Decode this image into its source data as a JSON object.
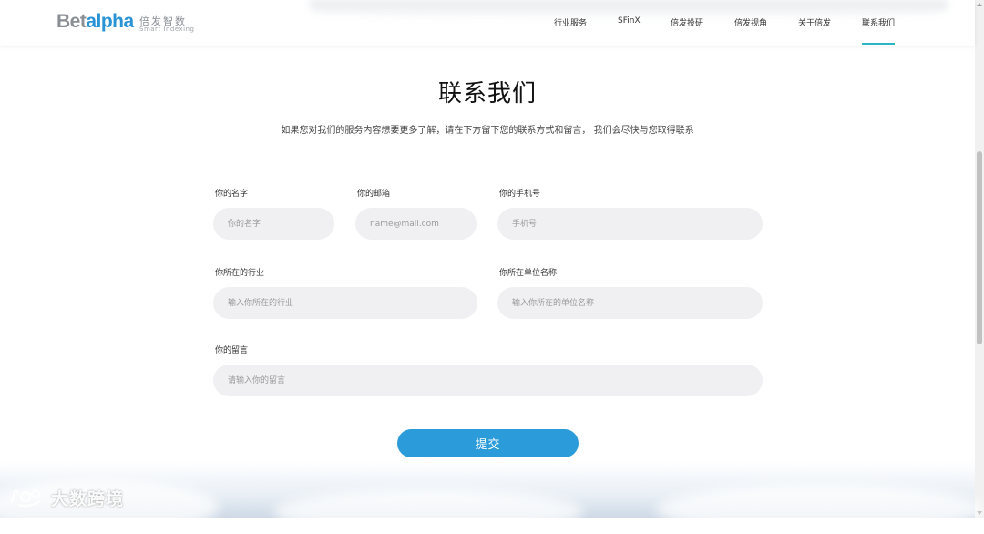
{
  "header": {
    "logo": {
      "word_a": "Bet",
      "word_b": "alpha",
      "cn": "倍发智数",
      "sub": "Smart Indexing"
    },
    "nav": [
      {
        "label": "行业服务",
        "active": false
      },
      {
        "label": "SFinX",
        "active": false
      },
      {
        "label": "倍发投研",
        "active": false
      },
      {
        "label": "倍发视角",
        "active": false
      },
      {
        "label": "关于倍发",
        "active": false
      },
      {
        "label": "联系我们",
        "active": true
      }
    ]
  },
  "main": {
    "title": "联系我们",
    "subtitle": "如果您对我们的服务内容想要更多了解，请在下方留下您的联系方式和留言， 我们会尽快与您取得联系",
    "form": {
      "name": {
        "label": "你的名字",
        "placeholder": "你的名字"
      },
      "email": {
        "label": "你的邮箱",
        "placeholder": "name@mail.com"
      },
      "phone": {
        "label": "你的手机号",
        "placeholder": "手机号"
      },
      "industry": {
        "label": "你所在的行业",
        "placeholder": "输入你所在的行业"
      },
      "company": {
        "label": "你所在单位名称",
        "placeholder": "输入你所在的单位名称"
      },
      "message": {
        "label": "你的留言",
        "placeholder": "请输入你的留言"
      },
      "submit_label": "提交"
    }
  },
  "watermark": {
    "text": "大数跨境"
  },
  "colors": {
    "accent": "#2b9bd9",
    "nav_underline": "#2ab4c6",
    "field_bg": "#f0f0f2"
  }
}
